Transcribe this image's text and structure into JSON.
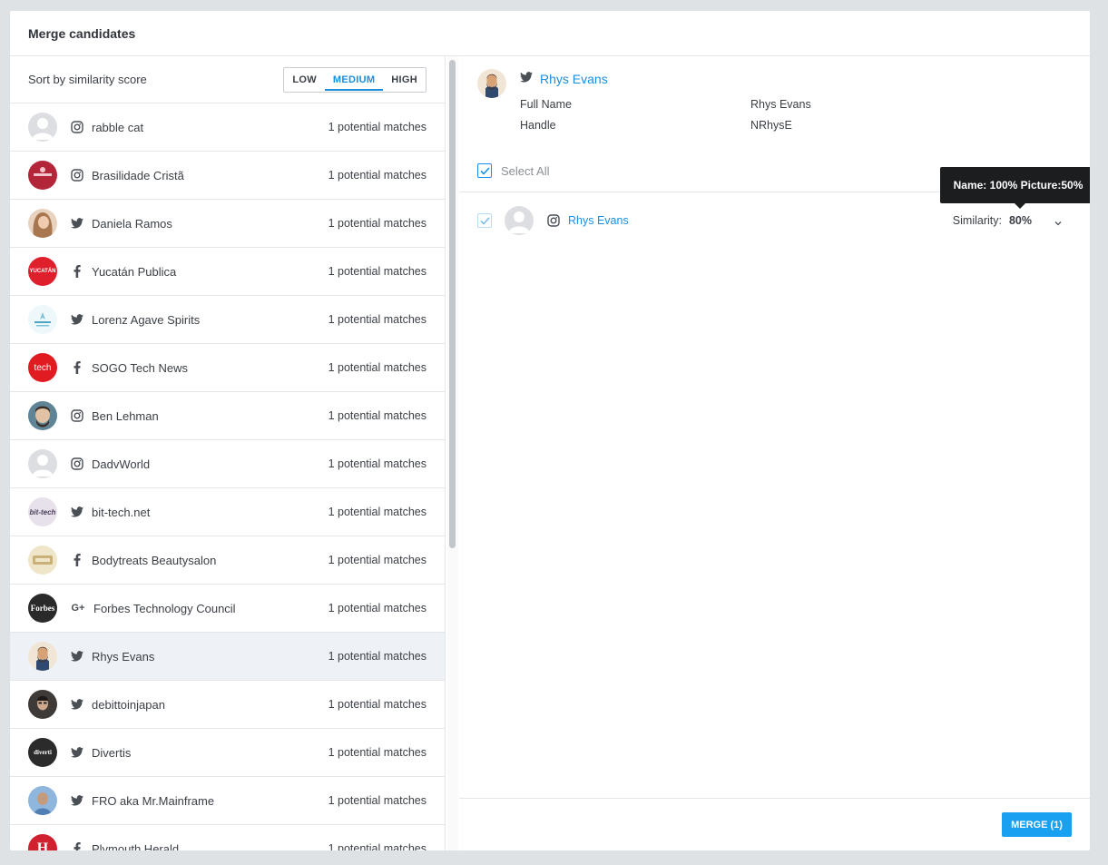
{
  "title": "Merge candidates",
  "sort": {
    "label": "Sort by similarity score",
    "options": [
      "LOW",
      "MEDIUM",
      "HIGH"
    ],
    "selected": "MEDIUM"
  },
  "candidates": [
    {
      "name": "rabble cat",
      "network": "instagram-icon",
      "count": "1 potential matches",
      "avatar_color": "#d4d6d9"
    },
    {
      "name": "Brasilidade Cristã",
      "network": "instagram-icon",
      "count": "1 potential matches",
      "avatar_color": "#b3263a"
    },
    {
      "name": "Daniela Ramos",
      "network": "twitter-icon",
      "count": "1 potential matches",
      "avatar_color": "#c9a38a"
    },
    {
      "name": "Yucatán Publica",
      "network": "facebook-icon",
      "count": "1 potential matches",
      "avatar_color": "#e01f2d"
    },
    {
      "name": "Lorenz Agave Spirits",
      "network": "twitter-icon",
      "count": "1 potential matches",
      "avatar_color": "#a9d8e6"
    },
    {
      "name": "SOGO Tech News",
      "network": "facebook-icon",
      "count": "1 potential matches",
      "avatar_color": "#e11b22"
    },
    {
      "name": "Ben Lehman",
      "network": "instagram-icon",
      "count": "1 potential matches",
      "avatar_color": "#4b6a7a"
    },
    {
      "name": "DadvWorld",
      "network": "instagram-icon",
      "count": "1 potential matches",
      "avatar_color": "#d4d6d9"
    },
    {
      "name": "bit-tech.net",
      "network": "twitter-icon",
      "count": "1 potential matches",
      "avatar_color": "#6c6170"
    },
    {
      "name": "Bodytreats Beautysalon",
      "network": "facebook-icon",
      "count": "1 potential matches",
      "avatar_color": "#d8c79a"
    },
    {
      "name": "Forbes Technology Council",
      "network": "googleplus-icon",
      "count": "1 potential matches",
      "avatar_color": "#2a2a2a"
    },
    {
      "name": "Rhys Evans",
      "network": "twitter-icon",
      "count": "1 potential matches",
      "avatar_color": "#c79d6b"
    },
    {
      "name": "debittoinjapan",
      "network": "twitter-icon",
      "count": "1 potential matches",
      "avatar_color": "#3d3a38"
    },
    {
      "name": "Divertis",
      "network": "twitter-icon",
      "count": "1 potential matches",
      "avatar_color": "#2b2b2b"
    },
    {
      "name": "FRO aka Mr.Mainframe",
      "network": "twitter-icon",
      "count": "1 potential matches",
      "avatar_color": "#6e9ccf"
    },
    {
      "name": "Plymouth Herald",
      "network": "facebook-icon",
      "count": "1 potential matches",
      "avatar_color": "#d1202f"
    }
  ],
  "selected_index": 11,
  "avatar_texts": {
    "yucatan": "YUCATÁN",
    "sogo": "tech",
    "bittech": "bit-tech",
    "forbes": "Forbes",
    "divertis": "diverti",
    "plymouth": "H"
  },
  "detail": {
    "name": "Rhys Evans",
    "network": "twitter-icon",
    "fields": [
      {
        "label": "Full Name",
        "value": "Rhys Evans"
      },
      {
        "label": "Handle",
        "value": "NRhysE"
      }
    ],
    "select_all": "Select All",
    "match": {
      "name": "Rhys Evans",
      "network": "instagram-icon",
      "similarity_label": "Similarity:",
      "similarity_value": "80%"
    },
    "tooltip": "Name: 100% Picture:50%",
    "merge_label": "MERGE (1)"
  },
  "colors": {
    "accent": "#1a8fe0",
    "merge": "#1aa0f0"
  }
}
